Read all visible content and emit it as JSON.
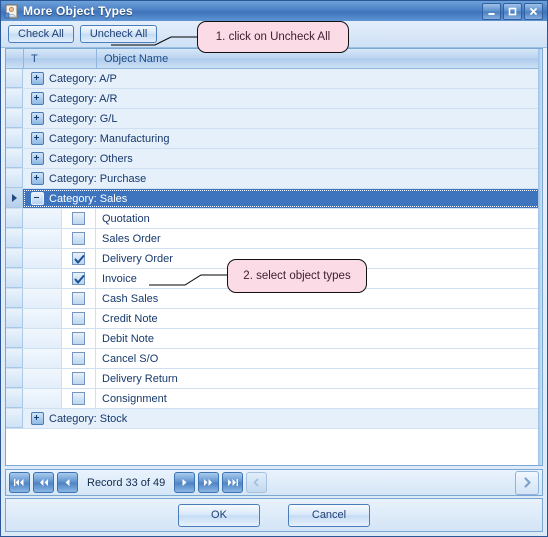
{
  "window": {
    "title": "More Object Types",
    "icon": "document-person-icon",
    "controls": [
      {
        "name": "minimize",
        "glyph": "minimize-icon"
      },
      {
        "name": "maximize",
        "glyph": "maximize-icon"
      },
      {
        "name": "close",
        "glyph": "close-icon"
      }
    ]
  },
  "toolbar": {
    "check_all_label": "Check All",
    "uncheck_all_label": "Uncheck All"
  },
  "grid": {
    "columns": [
      {
        "key": "t",
        "label": "T"
      },
      {
        "key": "object_name",
        "label": "Object Name"
      }
    ],
    "rows": [
      {
        "kind": "category",
        "label": "Category: A/P",
        "expanded": false,
        "selected": false
      },
      {
        "kind": "category",
        "label": "Category: A/R",
        "expanded": false,
        "selected": false
      },
      {
        "kind": "category",
        "label": "Category: G/L",
        "expanded": false,
        "selected": false
      },
      {
        "kind": "category",
        "label": "Category: Manufacturing",
        "expanded": false,
        "selected": false
      },
      {
        "kind": "category",
        "label": "Category: Others",
        "expanded": false,
        "selected": false
      },
      {
        "kind": "category",
        "label": "Category: Purchase",
        "expanded": false,
        "selected": false
      },
      {
        "kind": "category",
        "label": "Category: Sales",
        "expanded": true,
        "selected": true
      },
      {
        "kind": "item",
        "label": "Quotation",
        "checked": false
      },
      {
        "kind": "item",
        "label": "Sales Order",
        "checked": false
      },
      {
        "kind": "item",
        "label": "Delivery Order",
        "checked": true
      },
      {
        "kind": "item",
        "label": "Invoice",
        "checked": true
      },
      {
        "kind": "item",
        "label": "Cash Sales",
        "checked": false
      },
      {
        "kind": "item",
        "label": "Credit Note",
        "checked": false
      },
      {
        "kind": "item",
        "label": "Debit Note",
        "checked": false
      },
      {
        "kind": "item",
        "label": "Cancel S/O",
        "checked": false
      },
      {
        "kind": "item",
        "label": "Delivery Return",
        "checked": false
      },
      {
        "kind": "item",
        "label": "Consignment",
        "checked": false
      },
      {
        "kind": "category",
        "label": "Category: Stock",
        "expanded": false,
        "selected": false
      }
    ]
  },
  "navigator": {
    "record_text": "Record 33 of 49",
    "buttons": [
      {
        "name": "first-record-button",
        "glyph": "first-icon",
        "disabled": false
      },
      {
        "name": "prev-page-button",
        "glyph": "prev-fast-icon",
        "disabled": false
      },
      {
        "name": "prev-record-button",
        "glyph": "prev-icon",
        "disabled": false
      },
      {
        "name": "next-record-button",
        "glyph": "next-icon",
        "disabled": false
      },
      {
        "name": "next-page-button",
        "glyph": "next-fast-icon",
        "disabled": false
      },
      {
        "name": "last-record-button",
        "glyph": "last-icon",
        "disabled": false
      },
      {
        "name": "collapse-button",
        "glyph": "chevron-left-icon",
        "disabled": true
      }
    ],
    "expand_button": {
      "name": "expand-button",
      "glyph": "chevron-right-icon"
    }
  },
  "footer": {
    "ok_label": "OK",
    "cancel_label": "Cancel"
  },
  "annotations": [
    {
      "id": "callout1",
      "text": "1. click on Uncheck All"
    },
    {
      "id": "callout2",
      "text": "2. select object types"
    }
  ],
  "colors": {
    "title_bar": "#4b7fc4",
    "selection": "#3d74bd",
    "callout_fill": "#fadbe6",
    "grid_border": "#7aa7d4",
    "text_blue": "#17396b"
  }
}
